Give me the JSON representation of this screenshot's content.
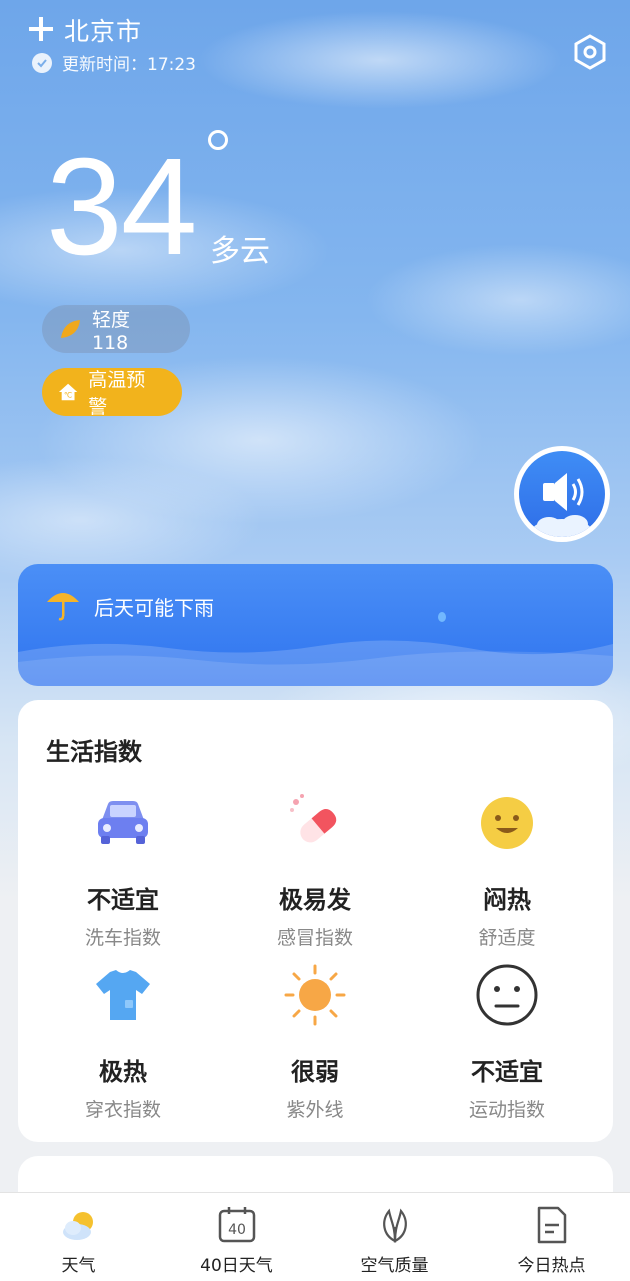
{
  "header": {
    "city": "北京市",
    "update_text": "更新时间：17:23"
  },
  "weather": {
    "temperature": "34",
    "condition": "多云"
  },
  "badges": {
    "aqi_label": "轻度118",
    "warning_label": "高温预警"
  },
  "rain_notice": {
    "text": "后天可能下雨"
  },
  "life_index": {
    "title": "生活指数",
    "items": [
      {
        "value": "不适宜",
        "label": "洗车指数",
        "icon": "car-icon"
      },
      {
        "value": "极易发",
        "label": "感冒指数",
        "icon": "pill-icon"
      },
      {
        "value": "闷热",
        "label": "舒适度",
        "icon": "smile-face-icon"
      },
      {
        "value": "极热",
        "label": "穿衣指数",
        "icon": "shirt-icon"
      },
      {
        "value": "很弱",
        "label": "紫外线",
        "icon": "sun-icon"
      },
      {
        "value": "不适宜",
        "label": "运动指数",
        "icon": "neutral-face-icon"
      }
    ]
  },
  "tabs": [
    {
      "label": "天气",
      "icon": "weather-icon"
    },
    {
      "label": "40日天气",
      "icon": "calendar-40-icon"
    },
    {
      "label": "空气质量",
      "icon": "leaf-icon"
    },
    {
      "label": "今日热点",
      "icon": "document-icon"
    }
  ],
  "colors": {
    "warning": "#f2b31c",
    "rain_card": "#3a7ff2",
    "accent_blue": "#2f6ee8"
  }
}
